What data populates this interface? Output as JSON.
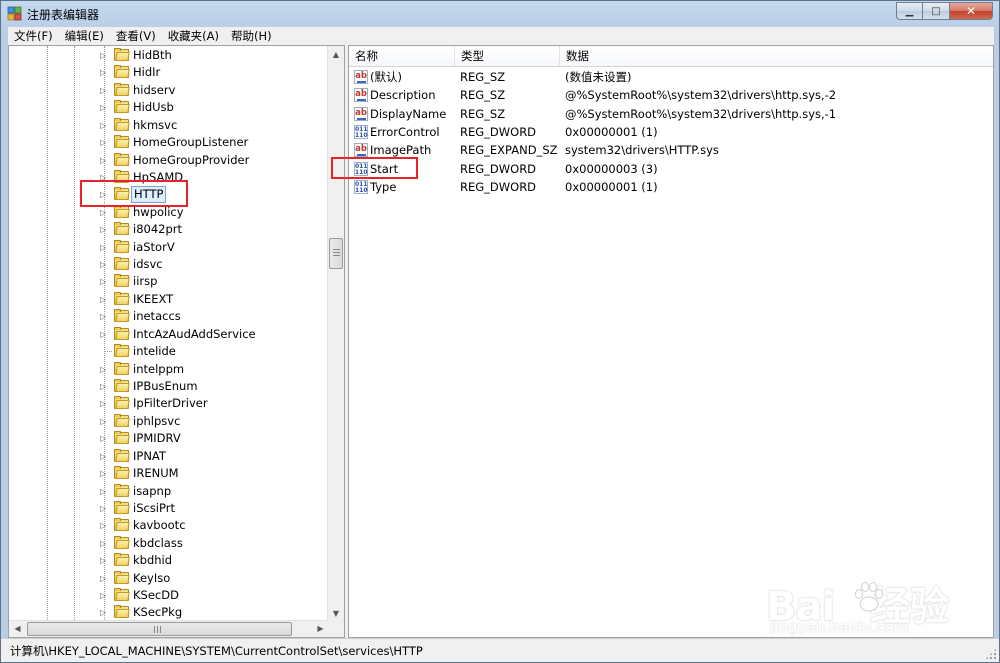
{
  "window": {
    "title": "注册表编辑器",
    "minimize_glyph": "▁",
    "maximize_glyph": "□",
    "close_glyph": "✕"
  },
  "menu": [
    {
      "label": "文件(F)"
    },
    {
      "label": "编辑(E)"
    },
    {
      "label": "查看(V)"
    },
    {
      "label": "收藏夹(A)"
    },
    {
      "label": "帮助(H)"
    }
  ],
  "tree": {
    "items": [
      {
        "label": "HidBth",
        "expandable": true
      },
      {
        "label": "HidIr",
        "expandable": true
      },
      {
        "label": "hidserv",
        "expandable": true
      },
      {
        "label": "HidUsb",
        "expandable": true
      },
      {
        "label": "hkmsvc",
        "expandable": true
      },
      {
        "label": "HomeGroupListener",
        "expandable": true
      },
      {
        "label": "HomeGroupProvider",
        "expandable": true
      },
      {
        "label": "HpSAMD",
        "expandable": true
      },
      {
        "label": "HTTP",
        "expandable": true,
        "selected": true
      },
      {
        "label": "hwpolicy",
        "expandable": true
      },
      {
        "label": "i8042prt",
        "expandable": true
      },
      {
        "label": "iaStorV",
        "expandable": true
      },
      {
        "label": "idsvc",
        "expandable": true
      },
      {
        "label": "iirsp",
        "expandable": true
      },
      {
        "label": "IKEEXT",
        "expandable": true
      },
      {
        "label": "inetaccs",
        "expandable": true
      },
      {
        "label": "IntcAzAudAddService",
        "expandable": true
      },
      {
        "label": "intelide",
        "expandable": false
      },
      {
        "label": "intelppm",
        "expandable": true
      },
      {
        "label": "IPBusEnum",
        "expandable": true
      },
      {
        "label": "IpFilterDriver",
        "expandable": true
      },
      {
        "label": "iphlpsvc",
        "expandable": true
      },
      {
        "label": "IPMIDRV",
        "expandable": true
      },
      {
        "label": "IPNAT",
        "expandable": true
      },
      {
        "label": "IRENUM",
        "expandable": true
      },
      {
        "label": "isapnp",
        "expandable": true
      },
      {
        "label": "iScsiPrt",
        "expandable": true
      },
      {
        "label": "kavbootc",
        "expandable": true
      },
      {
        "label": "kbdclass",
        "expandable": true
      },
      {
        "label": "kbdhid",
        "expandable": true
      },
      {
        "label": "KeyIso",
        "expandable": true
      },
      {
        "label": "KSecDD",
        "expandable": true
      },
      {
        "label": "KSecPkg",
        "expandable": true
      }
    ]
  },
  "list": {
    "columns": [
      {
        "label": "名称"
      },
      {
        "label": "类型"
      },
      {
        "label": "数据"
      }
    ],
    "rows": [
      {
        "icon": "string-value-icon",
        "name": "(默认)",
        "type": "REG_SZ",
        "data": "(数值未设置)"
      },
      {
        "icon": "string-value-icon",
        "name": "Description",
        "type": "REG_SZ",
        "data": "@%SystemRoot%\\system32\\drivers\\http.sys,-2"
      },
      {
        "icon": "string-value-icon",
        "name": "DisplayName",
        "type": "REG_SZ",
        "data": "@%SystemRoot%\\system32\\drivers\\http.sys,-1"
      },
      {
        "icon": "dword-value-icon",
        "name": "ErrorControl",
        "type": "REG_DWORD",
        "data": "0x00000001 (1)"
      },
      {
        "icon": "string-value-icon",
        "name": "ImagePath",
        "type": "REG_EXPAND_SZ",
        "data": "system32\\drivers\\HTTP.sys"
      },
      {
        "icon": "dword-value-icon",
        "name": "Start",
        "type": "REG_DWORD",
        "data": "0x00000003 (3)"
      },
      {
        "icon": "dword-value-icon",
        "name": "Type",
        "type": "REG_DWORD",
        "data": "0x00000001 (1)"
      }
    ]
  },
  "icons": {
    "sz_glyph": "ab",
    "dword_glyph": "011\n110",
    "arrow_up": "▲",
    "arrow_down": "▼",
    "arrow_left": "◀",
    "arrow_right": "▶",
    "expand": "▷"
  },
  "status": {
    "path": "计算机\\HKEY_LOCAL_MACHINE\\SYSTEM\\CurrentControlSet\\services\\HTTP"
  },
  "annotation_color": "#e8242a",
  "watermark": {
    "logo": "Bai  经验",
    "url": "jingyan.baidu.com"
  }
}
